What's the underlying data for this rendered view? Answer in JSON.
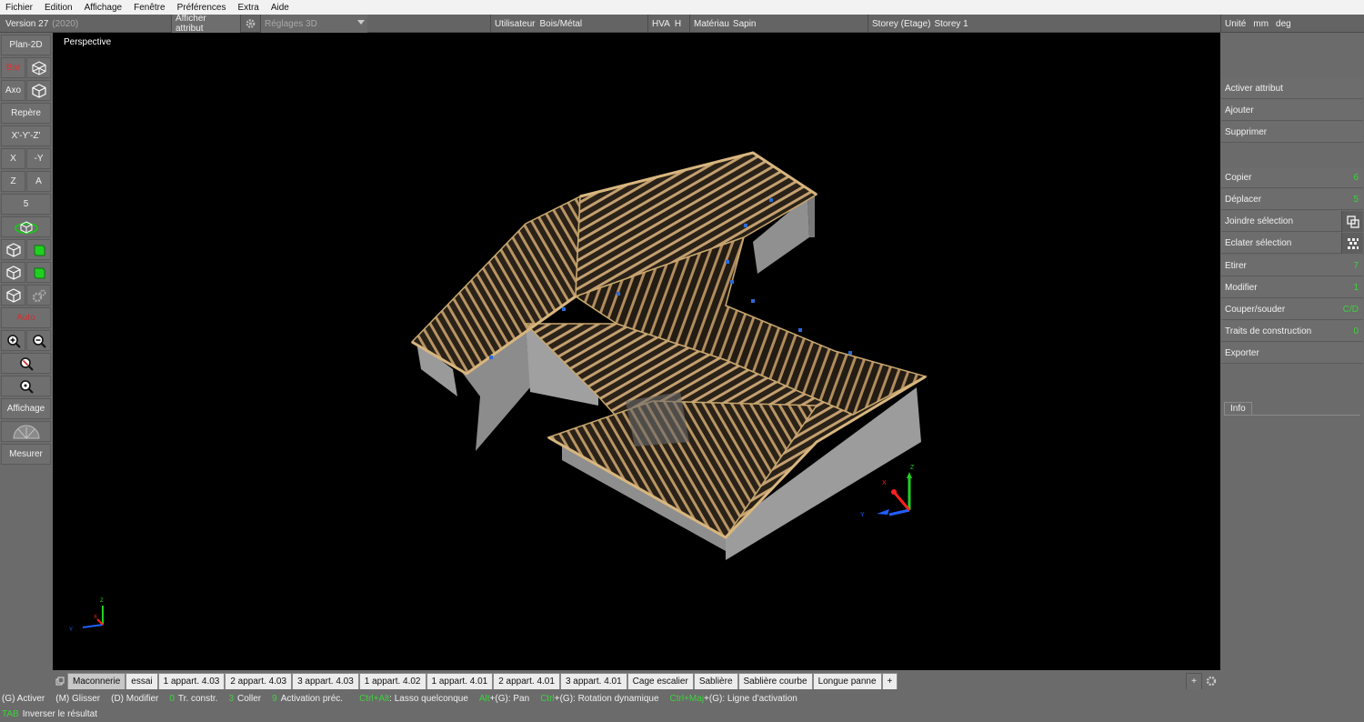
{
  "menu": [
    "Fichier",
    "Edition",
    "Affichage",
    "Fenêtre",
    "Préférences",
    "Extra",
    "Aide"
  ],
  "infobar": {
    "version": "Version 27",
    "year": "(2020)",
    "show_attr": "Afficher attribut",
    "settings3d": "Réglages 3D",
    "user_label": "Utilisateur",
    "user_value": "Bois/Métal",
    "hva_label": "HVA",
    "hva_value": "H",
    "material_label": "Matériau",
    "material_value": "Sapin",
    "storey_label": "Storey (Etage)",
    "storey_value": "Storey 1",
    "unit_label": "Unité",
    "unit_len": "mm",
    "unit_angle": "deg"
  },
  "left": {
    "plan2d": "Plan-2D",
    "bar": "Bar",
    "axo": "Axo",
    "repere": "Repère",
    "xyz": "X'-Y'-Z'",
    "x": "X",
    "neg_y": "-Y",
    "z": "Z",
    "a": "A",
    "five": "5",
    "auto": "Auto",
    "affichage": "Affichage",
    "mesurer": "Mesurer"
  },
  "viewport": {
    "label": "Perspective"
  },
  "right": {
    "items": [
      {
        "label": "Activer attribut",
        "shortcut": ""
      },
      {
        "label": "Ajouter",
        "shortcut": ""
      },
      {
        "label": "Supprimer",
        "shortcut": ""
      },
      {
        "label": "Copier",
        "shortcut": "6"
      },
      {
        "label": "Déplacer",
        "shortcut": "5"
      },
      {
        "label": "Joindre sélection",
        "shortcut": ""
      },
      {
        "label": "Eclater sélection",
        "shortcut": ""
      },
      {
        "label": "Etirer",
        "shortcut": "7"
      },
      {
        "label": "Modifier",
        "shortcut": "1"
      },
      {
        "label": "Couper/souder",
        "shortcut": "C/D"
      },
      {
        "label": "Traits de construction",
        "shortcut": "0"
      },
      {
        "label": "Exporter",
        "shortcut": ""
      }
    ],
    "info_tab": "Info"
  },
  "tabs": [
    "Maconnerie",
    "essai",
    "1 appart. 4.03",
    "2 appart. 4.03",
    "3 appart. 4.03",
    "1 appart. 4.02",
    "1 appart. 4.01",
    "2 appart. 4.01",
    "3 appart. 4.01",
    "Cage escalier",
    "Sablière",
    "Sablière courbe",
    "Longue panne",
    "+"
  ],
  "active_tab": 0,
  "tab_add": "+",
  "status": {
    "h1": "(G) Activer",
    "h2": "(M) Glisser",
    "h3": "(D) Modifier",
    "k4": "0",
    "h4": "Tr. constr.",
    "k5": "3",
    "h5": "Coller",
    "k6": "9",
    "h6": "Activation préc.",
    "k7": "Ctrl+Alt",
    "h7": ": Lasso quelconque",
    "k8": "Alt",
    "h8": "+(G): Pan",
    "k9": "Ctrl",
    "h9": "+(G): Rotation dynamique",
    "k10": "Ctrl+Maj",
    "h10": "+(G): Ligne d'activation",
    "k11": "TAB",
    "h11": "Inverser le résultat"
  },
  "axis": {
    "x": "X",
    "y": "Y",
    "z": "Z"
  },
  "colors": {
    "viewport": "#000000",
    "timber": "#b89564",
    "wall": "#8c8c8c",
    "shortcut": "#3cd23c",
    "axis_x": "#ff2020",
    "axis_y": "#2060ff",
    "axis_z": "#20d020"
  }
}
